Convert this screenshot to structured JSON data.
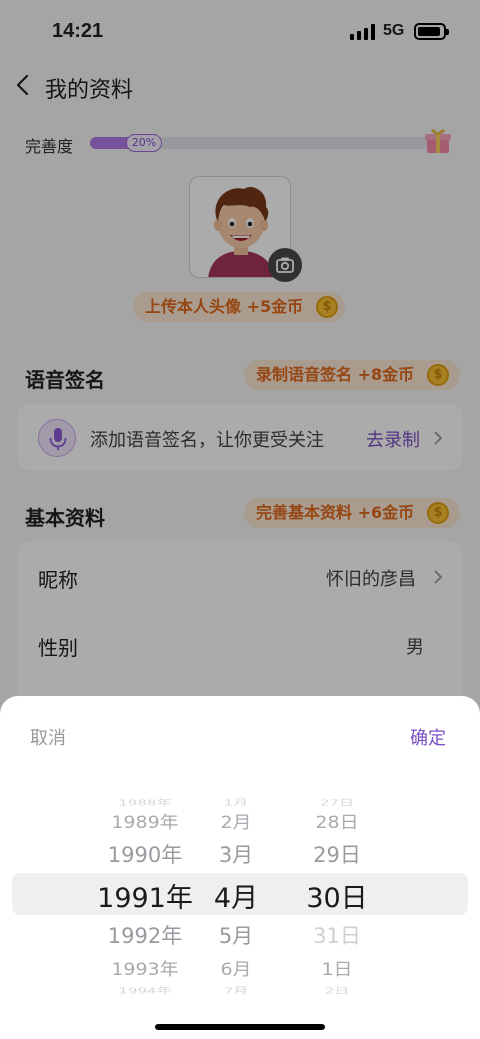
{
  "status_bar": {
    "time": "14:21",
    "network": "5G"
  },
  "nav": {
    "title": "我的资料"
  },
  "completion": {
    "label": "完善度",
    "percent_text": "20%",
    "percent": 20
  },
  "avatar_reward": {
    "text": "上传本人头像 +5金币",
    "coin": "$"
  },
  "voice": {
    "title": "语音签名",
    "reward": "录制语音签名 +8金币",
    "hint": "添加语音签名，让你更受关注",
    "action": "去录制"
  },
  "basic": {
    "title": "基本资料",
    "reward": "完善基本资料 +6金币",
    "rows": [
      {
        "label": "昵称",
        "value": "怀旧的彦昌"
      },
      {
        "label": "性别",
        "value": "男"
      }
    ]
  },
  "picker": {
    "cancel": "取消",
    "confirm": "确定",
    "years": [
      "1988年",
      "1989年",
      "1990年",
      "1991年",
      "1992年",
      "1993年",
      "1994年"
    ],
    "months": [
      "1月",
      "2月",
      "3月",
      "4月",
      "5月",
      "6月",
      "7月"
    ],
    "days": [
      "27日",
      "28日",
      "29日",
      "30日",
      "31日",
      "1日",
      "2日"
    ],
    "selected_index": 3
  },
  "colors": {
    "accent": "#7b4fc4",
    "reward_orange": "#e0691c",
    "progress": "#b07be6"
  }
}
